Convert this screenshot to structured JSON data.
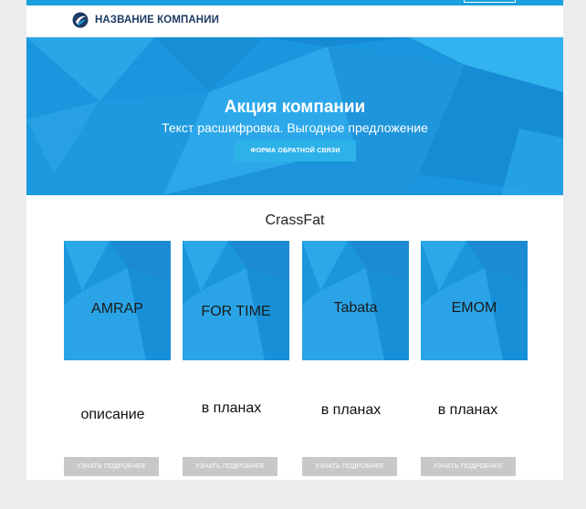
{
  "header": {
    "company_name": "НАЗВАНИЕ КОМПАНИИ"
  },
  "hero": {
    "title": "Акция компании",
    "subtitle": "Текст расшифровка. Выгодное предложение",
    "button_label": "ФОРМА ОБРАТНОЙ СВЯЗИ"
  },
  "section": {
    "title": "CrassFat"
  },
  "cards": [
    {
      "label": "AMRAP",
      "description": "описание",
      "button_label": "УЗНАТЬ ПОДРОБНЕЕ"
    },
    {
      "label": "FOR TIME",
      "description": "в планах",
      "button_label": "УЗНАТЬ ПОДРОБНЕЕ"
    },
    {
      "label": "Tabata",
      "description": "в планах",
      "button_label": "УЗНАТЬ ПОДРОБНЕЕ"
    },
    {
      "label": "EMOM",
      "description": "в планах",
      "button_label": "УЗНАТЬ ПОДРОБНЕЕ"
    }
  ],
  "colors": {
    "brand_blue": "#1aa0de",
    "button_gray": "#c8c8c8",
    "navy": "#1d3b63"
  },
  "icons": {
    "logo": "company-logo-icon"
  }
}
